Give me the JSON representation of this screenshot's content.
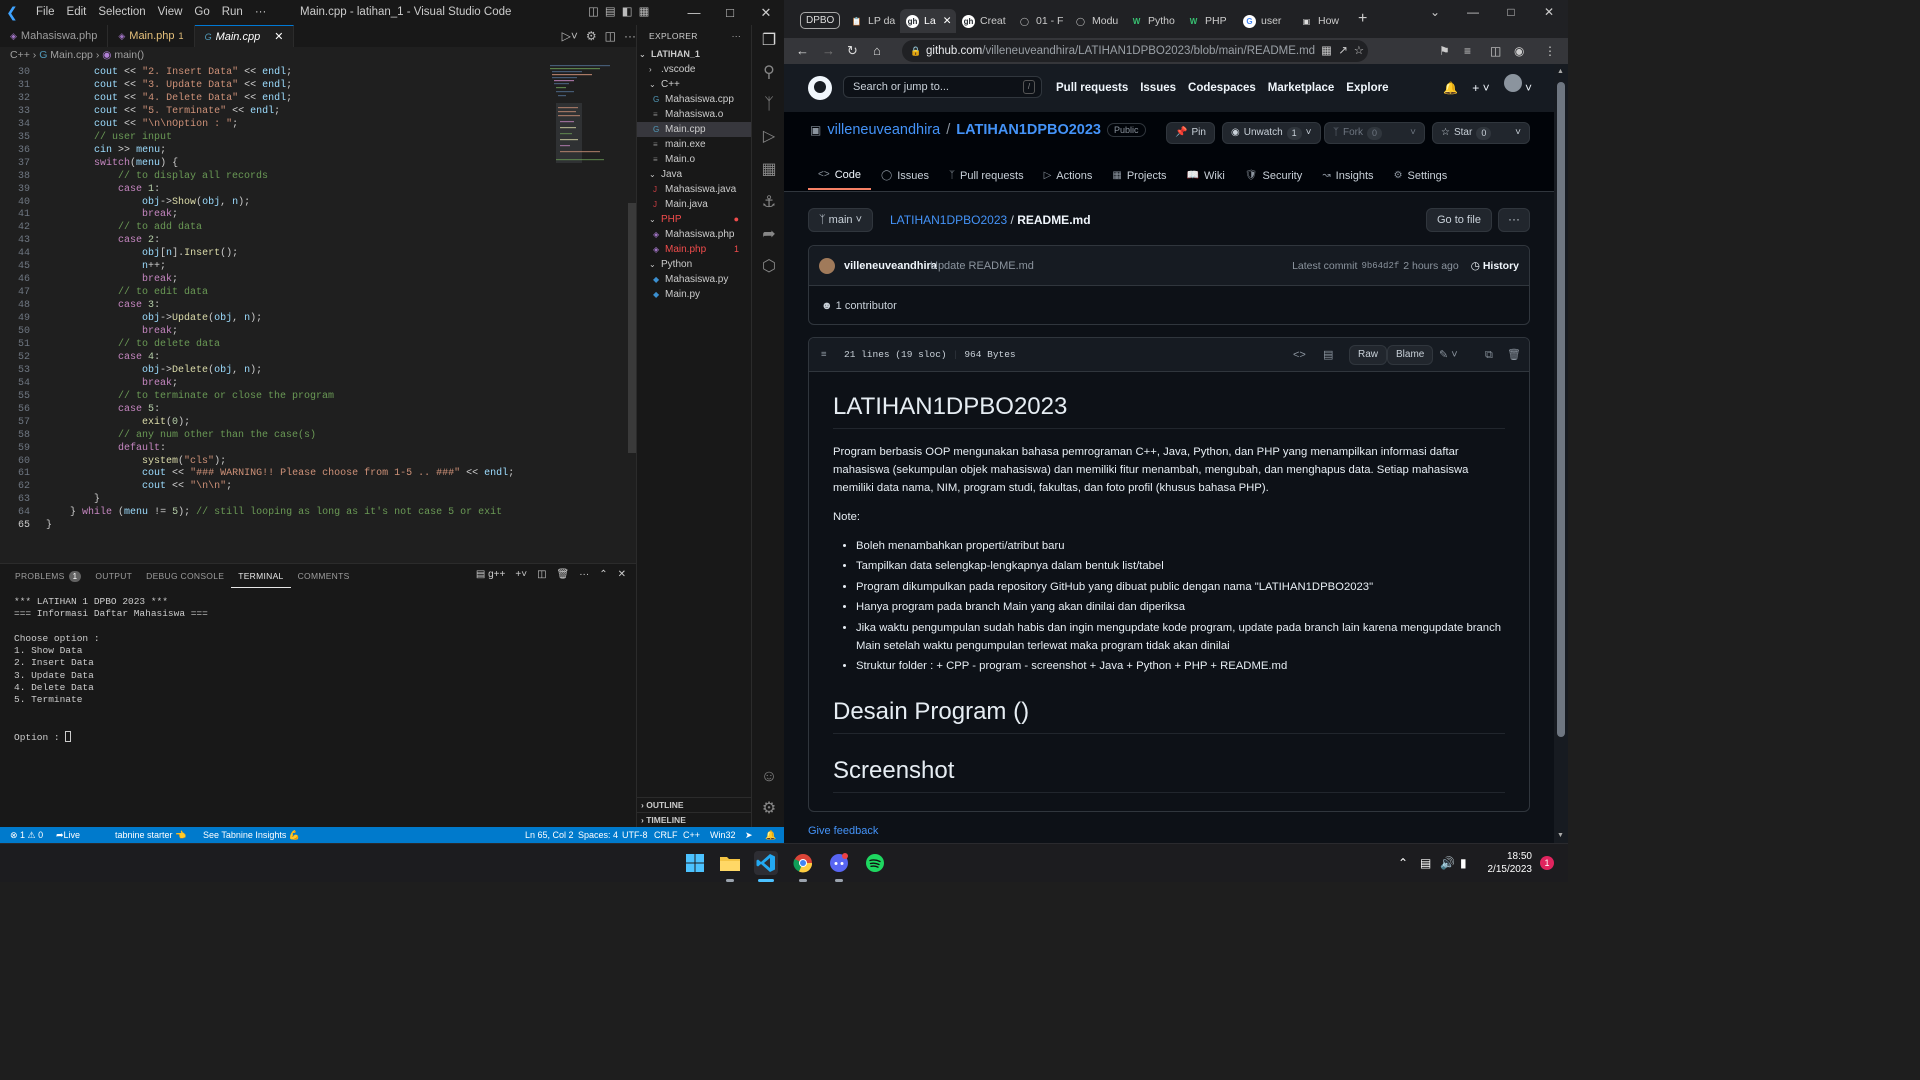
{
  "vscode": {
    "menu": [
      "File",
      "Edit",
      "Selection",
      "View",
      "Go",
      "Run",
      "···"
    ],
    "window_title": "Main.cpp - latihan_1 - Visual Studio Code",
    "tabs": [
      {
        "label": "Mahasiswa.php",
        "badge": ""
      },
      {
        "label": "Main.php",
        "badge": "1"
      },
      {
        "label": "Main.cpp",
        "badge": ""
      }
    ],
    "breadcrumb": {
      "lang": "C++",
      "file": "Main.cpp",
      "symbol": "main()"
    },
    "code_lines": [
      {
        "n": "30",
        "html": "        <span class='vr'>cout</span> <span class='op'>&lt;&lt;</span> <span class='st'>\"2. Insert Data\"</span> <span class='op'>&lt;&lt;</span> <span class='vr'>endl</span>;"
      },
      {
        "n": "31",
        "html": "        <span class='vr'>cout</span> <span class='op'>&lt;&lt;</span> <span class='st'>\"3. Update Data\"</span> <span class='op'>&lt;&lt;</span> <span class='vr'>endl</span>;"
      },
      {
        "n": "32",
        "html": "        <span class='vr'>cout</span> <span class='op'>&lt;&lt;</span> <span class='st'>\"4. Delete Data\"</span> <span class='op'>&lt;&lt;</span> <span class='vr'>endl</span>;"
      },
      {
        "n": "33",
        "html": "        <span class='vr'>cout</span> <span class='op'>&lt;&lt;</span> <span class='st'>\"5. Terminate\"</span> <span class='op'>&lt;&lt;</span> <span class='vr'>endl</span>;"
      },
      {
        "n": "34",
        "html": "        <span class='vr'>cout</span> <span class='op'>&lt;&lt;</span> <span class='st'>\"\\n\\nOption : \"</span>;"
      },
      {
        "n": "35",
        "html": "        <span class='cm'>// user input</span>"
      },
      {
        "n": "36",
        "html": "        <span class='vr'>cin</span> <span class='op'>&gt;&gt;</span> <span class='vr'>menu</span>;"
      },
      {
        "n": "37",
        "html": "        <span class='kw'>switch</span>(<span class='vr'>menu</span>) {"
      },
      {
        "n": "38",
        "html": "            <span class='cm'>// to display all records</span>"
      },
      {
        "n": "39",
        "html": "            <span class='kw'>case</span> <span class='nm'>1</span>:"
      },
      {
        "n": "40",
        "html": "                <span class='vr'>obj</span>-&gt;<span class='fn'>Show</span>(<span class='vr'>obj</span>, <span class='vr'>n</span>);"
      },
      {
        "n": "41",
        "html": "                <span class='kw'>break</span>;"
      },
      {
        "n": "42",
        "html": "            <span class='cm'>// to add data</span>"
      },
      {
        "n": "43",
        "html": "            <span class='kw'>case</span> <span class='nm'>2</span>:"
      },
      {
        "n": "44",
        "html": "                <span class='vr'>obj</span>[<span class='vr'>n</span>].<span class='fn'>Insert</span>();"
      },
      {
        "n": "45",
        "html": "                <span class='vr'>n</span>++;"
      },
      {
        "n": "46",
        "html": "                <span class='kw'>break</span>;"
      },
      {
        "n": "47",
        "html": "            <span class='cm'>// to edit data</span>"
      },
      {
        "n": "48",
        "html": "            <span class='kw'>case</span> <span class='nm'>3</span>:"
      },
      {
        "n": "49",
        "html": "                <span class='vr'>obj</span>-&gt;<span class='fn'>Update</span>(<span class='vr'>obj</span>, <span class='vr'>n</span>);"
      },
      {
        "n": "50",
        "html": "                <span class='kw'>break</span>;"
      },
      {
        "n": "51",
        "html": "            <span class='cm'>// to delete data</span>"
      },
      {
        "n": "52",
        "html": "            <span class='kw'>case</span> <span class='nm'>4</span>:"
      },
      {
        "n": "53",
        "html": "                <span class='vr'>obj</span>-&gt;<span class='fn'>Delete</span>(<span class='vr'>obj</span>, <span class='vr'>n</span>);"
      },
      {
        "n": "54",
        "html": "                <span class='kw'>break</span>;"
      },
      {
        "n": "55",
        "html": "            <span class='cm'>// to terminate or close the program</span>"
      },
      {
        "n": "56",
        "html": "            <span class='kw'>case</span> <span class='nm'>5</span>:"
      },
      {
        "n": "57",
        "html": "                <span class='fn'>exit</span>(<span class='nm'>0</span>);"
      },
      {
        "n": "58",
        "html": "            <span class='cm'>// any num other than the case(s)</span>"
      },
      {
        "n": "59",
        "html": "            <span class='kw'>default</span>:"
      },
      {
        "n": "60",
        "html": "                <span class='fn'>system</span>(<span class='st'>\"cls\"</span>);"
      },
      {
        "n": "61",
        "html": "                <span class='vr'>cout</span> <span class='op'>&lt;&lt;</span> <span class='st'>\"### WARNING!! Please choose from 1-5 .. ###\"</span> <span class='op'>&lt;&lt;</span> <span class='vr'>endl</span>;"
      },
      {
        "n": "62",
        "html": "                <span class='vr'>cout</span> <span class='op'>&lt;&lt;</span> <span class='st'>\"\\n\\n\"</span>;"
      },
      {
        "n": "63",
        "html": "        }"
      },
      {
        "n": "64",
        "html": "    } <span class='kw'>while</span> (<span class='vr'>menu</span> != <span class='nm'>5</span>); <span class='cm'>// still looping as long as it's not case 5 or exit</span>"
      },
      {
        "n": "65",
        "html": "}"
      }
    ],
    "panel_tabs": [
      {
        "label": "PROBLEMS",
        "badge": "1"
      },
      {
        "label": "OUTPUT",
        "badge": ""
      },
      {
        "label": "DEBUG CONSOLE",
        "badge": ""
      },
      {
        "label": "TERMINAL",
        "badge": ""
      },
      {
        "label": "COMMENTS",
        "badge": ""
      }
    ],
    "terminal_shell": "g++",
    "terminal_lines": [
      "*** LATIHAN 1 DPBO 2023 ***",
      "=== Informasi Daftar Mahasiswa ===",
      "",
      "Choose option :",
      "1. Show Data",
      "2. Insert Data",
      "3. Update Data",
      "4. Delete Data",
      "5. Terminate",
      "",
      ""
    ],
    "terminal_prompt": "Option : ",
    "explorer": {
      "title": "EXPLORER",
      "root": "LATIHAN_1",
      "items": [
        {
          "label": ".vscode",
          "type": "folder-collapsed",
          "indent": 1,
          "color": "#ccc",
          "dirty": ""
        },
        {
          "label": "C++",
          "type": "folder-open",
          "indent": 1,
          "color": "#ccc",
          "dirty": ""
        },
        {
          "label": "Mahasiswa.cpp",
          "type": "cpp",
          "indent": 2,
          "color": "#ccc",
          "dirty": ""
        },
        {
          "label": "Mahasiswa.o",
          "type": "file",
          "indent": 2,
          "color": "#ccc",
          "dirty": ""
        },
        {
          "label": "Main.cpp",
          "type": "cpp",
          "indent": 2,
          "color": "#ccc",
          "dirty": "",
          "selected": true
        },
        {
          "label": "main.exe",
          "type": "file",
          "indent": 2,
          "color": "#ccc",
          "dirty": ""
        },
        {
          "label": "Main.o",
          "type": "file",
          "indent": 2,
          "color": "#ccc",
          "dirty": ""
        },
        {
          "label": "Java",
          "type": "folder-open",
          "indent": 1,
          "color": "#ccc",
          "dirty": ""
        },
        {
          "label": "Mahasiswa.java",
          "type": "java",
          "indent": 2,
          "color": "#ccc",
          "dirty": ""
        },
        {
          "label": "Main.java",
          "type": "java",
          "indent": 2,
          "color": "#ccc",
          "dirty": ""
        },
        {
          "label": "PHP",
          "type": "folder-open",
          "indent": 1,
          "color": "#f14c4c",
          "dirty": "●"
        },
        {
          "label": "Mahasiswa.php",
          "type": "php",
          "indent": 2,
          "color": "#ccc",
          "dirty": ""
        },
        {
          "label": "Main.php",
          "type": "php",
          "indent": 2,
          "color": "#f14c4c",
          "dirty": "1"
        },
        {
          "label": "Python",
          "type": "folder-open",
          "indent": 1,
          "color": "#ccc",
          "dirty": ""
        },
        {
          "label": "Mahasiswa.py",
          "type": "py",
          "indent": 2,
          "color": "#ccc",
          "dirty": ""
        },
        {
          "label": "Main.py",
          "type": "py",
          "indent": 2,
          "color": "#ccc",
          "dirty": ""
        }
      ],
      "outline": "OUTLINE",
      "timeline": "TIMELINE"
    },
    "status": {
      "problems": "⊗ 1 ⚠ 0",
      "liveshare": "Live Share",
      "tabnine": "tabnine starter 👈",
      "tabnine_insights": "See Tabnine Insights 💪",
      "position": "Ln 65, Col 2",
      "spaces": "Spaces: 4",
      "encoding": "UTF-8",
      "eol": "CRLF",
      "lang": "C++",
      "platform": "Win32"
    }
  },
  "chrome": {
    "tab_group": "DPBO",
    "tabs": [
      {
        "label": "LP da",
        "fav": "📋"
      },
      {
        "label": "La",
        "fav": "gh",
        "active": true
      },
      {
        "label": "Creat",
        "fav": "gh"
      },
      {
        "label": "01 - F",
        "fav": "◯"
      },
      {
        "label": "Modu",
        "fav": "◯"
      },
      {
        "label": "Pytho",
        "fav": "W"
      },
      {
        "label": "PHP",
        "fav": "W"
      },
      {
        "label": "user",
        "fav": "G"
      },
      {
        "label": "How",
        "fav": "▣"
      }
    ],
    "url_host": "github.com",
    "url_path": "/villeneuveandhira/LATIHAN1DPBO2023/blob/main/README.md"
  },
  "github": {
    "search_placeholder": "Search or jump to...",
    "nav": [
      "Pull requests",
      "Issues",
      "Codespaces",
      "Marketplace",
      "Explore"
    ],
    "owner": "villeneuveandhira",
    "repo": "LATIHAN1DPBO2023",
    "visibility": "Public",
    "pin_label": "Pin",
    "unwatch_label": "Unwatch",
    "unwatch_count": "1",
    "fork_label": "Fork",
    "fork_count": "0",
    "star_label": "Star",
    "star_count": "0",
    "repo_tabs": [
      "Code",
      "Issues",
      "Pull requests",
      "Actions",
      "Projects",
      "Wiki",
      "Security",
      "Insights",
      "Settings"
    ],
    "branch": "main",
    "path_repo": "LATIHAN1DPBO2023",
    "path_file": "README.md",
    "go_to_file": "Go to file",
    "commit_author": "villeneuveandhira",
    "commit_message": "Update README.md",
    "latest_commit_label": "Latest commit",
    "commit_hash": "9b64d2f",
    "commit_time": "2 hours ago",
    "history_label": "History",
    "contributors": "1 contributor",
    "file_lines": "21 lines (19 sloc)",
    "file_size": "964 Bytes",
    "raw_label": "Raw",
    "blame_label": "Blame",
    "readme": {
      "h1": "LATIHAN1DPBO2023",
      "intro": "Program berbasis OOP mengunakan bahasa pemrograman C++, Java, Python, dan PHP yang menampilkan informasi daftar mahasiswa (sekumpulan objek mahasiswa) dan memiliki fitur menambah, mengubah, dan menghapus data. Setiap mahasiswa memiliki data nama, NIM, program studi, fakultas, dan foto profil (khusus bahasa PHP).",
      "note": "Note:",
      "bullets": [
        "Boleh menambahkan properti/atribut baru",
        "Tampilkan data selengkap-lengkapnya dalam bentuk list/tabel",
        "Program dikumpulkan pada repository GitHub yang dibuat public dengan nama \"LATIHAN1DPBO2023\"",
        "Hanya program pada branch Main yang akan dinilai dan diperiksa",
        "Jika waktu pengumpulan sudah habis dan ingin mengupdate kode program, update pada branch lain karena mengupdate branch Main setelah waktu pengumpulan terlewat maka program tidak akan dinilai",
        "Struktur folder : + CPP - program - screenshot + Java + Python + PHP + README.md"
      ],
      "h2a": "Desain Program ()",
      "h2b": "Screenshot"
    },
    "feedback": "Give feedback"
  },
  "taskbar": {
    "time": "18:50",
    "date": "2/15/2023",
    "notifications": "1"
  }
}
